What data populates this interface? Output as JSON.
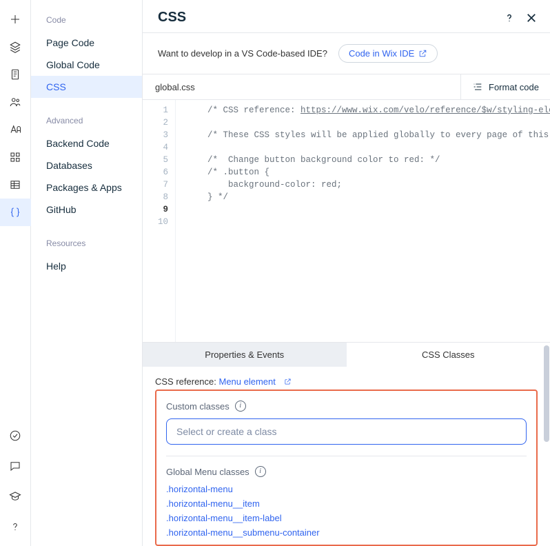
{
  "rail": {
    "items": [
      {
        "name": "add-icon"
      },
      {
        "name": "layers-icon"
      },
      {
        "name": "page-icon"
      },
      {
        "name": "team-icon"
      },
      {
        "name": "text-icon"
      },
      {
        "name": "grid-apps-icon"
      },
      {
        "name": "table-icon"
      },
      {
        "name": "braces-icon",
        "active": true
      }
    ],
    "bottom": [
      {
        "name": "check-circle-icon"
      },
      {
        "name": "chat-icon"
      },
      {
        "name": "grad-cap-icon"
      },
      {
        "name": "help-icon"
      }
    ]
  },
  "sidebar": {
    "groups": [
      {
        "title": "Code",
        "items": [
          {
            "label": "Page Code"
          },
          {
            "label": "Global Code"
          },
          {
            "label": "CSS",
            "active": true
          }
        ]
      },
      {
        "title": "Advanced",
        "items": [
          {
            "label": "Backend Code"
          },
          {
            "label": "Databases"
          },
          {
            "label": "Packages & Apps"
          },
          {
            "label": "GitHub"
          }
        ]
      },
      {
        "title": "Resources",
        "items": [
          {
            "label": "Help"
          }
        ]
      }
    ]
  },
  "panel": {
    "title": "CSS",
    "prompt_text": "Want to develop in a VS Code-based IDE?",
    "ide_link_label": "Code in Wix IDE"
  },
  "filebar": {
    "filename": "global.css",
    "format_label": "Format code"
  },
  "editor": {
    "line_count": 10,
    "current_line": 9,
    "lines": [
      "/* CSS reference: https://www.wix.com/velo/reference/$w/styling-elem",
      "",
      "/* These CSS styles will be applied globally to every page of this s",
      "",
      "/*  Change button background color to red: */",
      "/* .button {",
      "    background-color: red;",
      "} */",
      "",
      ""
    ],
    "url_fragment": "https://www.wix.com/velo/reference/$w/styling-elem"
  },
  "bottom": {
    "tabs": [
      {
        "label": "Properties & Events",
        "active": true
      },
      {
        "label": "CSS Classes"
      }
    ],
    "ref_prefix": "CSS reference: ",
    "ref_link": "Menu element",
    "custom_classes_label": "Custom classes",
    "input_placeholder": "Select or create a class",
    "global_classes_label": "Global Menu classes",
    "classes": [
      ".horizontal-menu",
      ".horizontal-menu__item",
      ".horizontal-menu__item-label",
      ".horizontal-menu__submenu-container"
    ]
  }
}
